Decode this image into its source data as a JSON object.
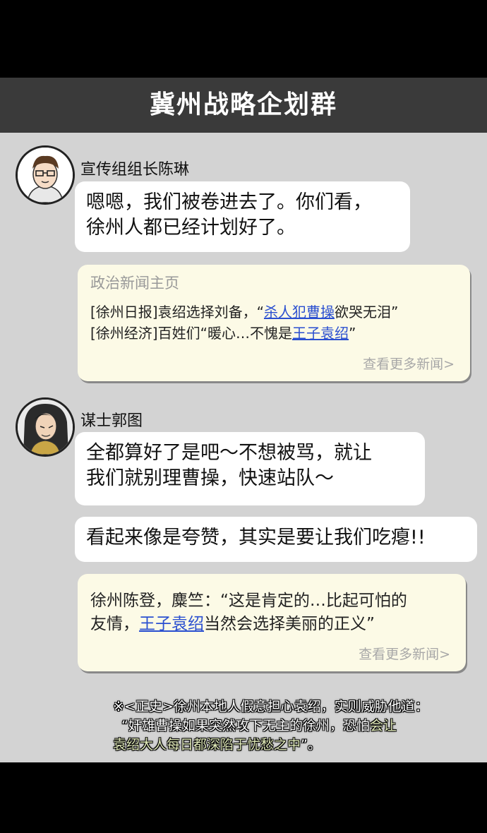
{
  "chat": {
    "title": "冀州战略企划群",
    "messages": [
      {
        "sender": "宣传组组长陈琳",
        "bubbles": [
          "嗯嗯，我们被卷进去了。你们看，\n徐州人都已经计划好了。"
        ],
        "card": {
          "header": "政治新闻主页",
          "lines": [
            {
              "pre": "[徐州日报]袁绍选择刘备，“",
              "link": "杀人犯曹操",
              "post": "欲哭无泪”"
            },
            {
              "pre": "[徐州经济]百姓们“暖心…不愧是",
              "link": "王子袁绍",
              "post": "”"
            }
          ],
          "more": "查看更多新闻>"
        }
      },
      {
        "sender": "谋士郭图",
        "bubbles": [
          "全都算好了是吧～不想被骂，就让\n我们就别理曹操，快速站队～",
          "看起来像是夸赞，其实是要让我们吃瘪!!"
        ],
        "card": {
          "line1": "徐州陈登，麋竺：“这是肯定的…比起可怕的",
          "pre2": "友情，",
          "link2": "王子袁绍",
          "post2": "当然会选择美丽的正义”",
          "more": "查看更多新闻>"
        }
      }
    ]
  },
  "footnote": {
    "line1": "※<正史>徐州本地人假意担心袁绍，实则威胁他道：",
    "line2a": "“奸雄曹操如果突然攻下无主的徐州，恐怕",
    "line2b": "会让",
    "line3a": "袁绍大人每日都深陷于忧愁之中",
    "line3b": "”。"
  },
  "colors": {
    "header_bg": "#3a3a3a",
    "panel_bg": "#d3d3d3",
    "card_bg": "#fcfae6",
    "link": "#2a4fd0"
  }
}
